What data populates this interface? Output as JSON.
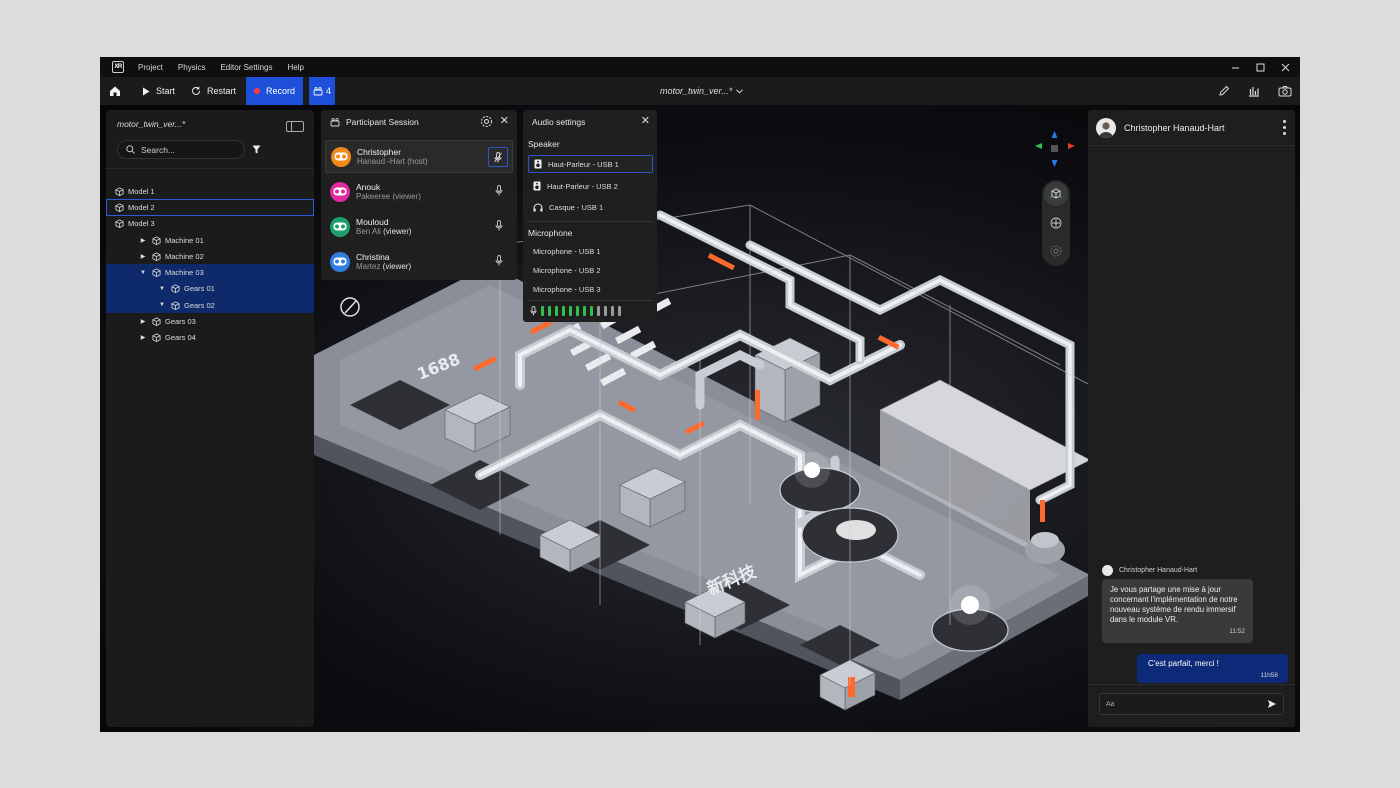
{
  "menubar": {
    "logo_text": "XR",
    "items": [
      "Project",
      "Physics",
      "Editor Settings",
      "Help"
    ]
  },
  "toolbar": {
    "start_label": "Start",
    "restart_label": "Restart",
    "record_label": "Record",
    "participants_count": "4",
    "document_title": "motor_twin_ver...*"
  },
  "scene_panel": {
    "title": "motor_twin_ver...*",
    "search_placeholder": "Search...",
    "tree": [
      {
        "label": "Model 1",
        "depth": 0,
        "arrow": ""
      },
      {
        "label": "Model 2",
        "depth": 0,
        "arrow": "",
        "state": "outline"
      },
      {
        "label": "Model 3",
        "depth": 0,
        "arrow": ""
      },
      {
        "label": "Machine 01",
        "depth": 1,
        "arrow": "▶"
      },
      {
        "label": "Machine 02",
        "depth": 1,
        "arrow": "▶"
      },
      {
        "label": "Machine 03",
        "depth": 1,
        "arrow": "▼",
        "state": "fill"
      },
      {
        "label": "Gears 01",
        "depth": 2,
        "arrow": "▼",
        "state": "fill"
      },
      {
        "label": "Gears 02",
        "depth": 2,
        "arrow": "▼",
        "state": "fill"
      },
      {
        "label": "Gears 03",
        "depth": 1,
        "arrow": "▶"
      },
      {
        "label": "Gears 04",
        "depth": 1,
        "arrow": "▶"
      }
    ]
  },
  "participant_panel": {
    "title": "Participant Session",
    "participants": [
      {
        "name": "Christopher",
        "sub": "Hanaud -Hart (host)",
        "role": "",
        "color": "#f08a1c",
        "active": true
      },
      {
        "name": "Anouk",
        "sub": "Pakeeree (viewer)",
        "role": "",
        "color": "#e02aa0",
        "active": false
      },
      {
        "name": "Mouloud",
        "sub": "Ben Ali ",
        "role": "(viewer)",
        "color": "#1e9e6a",
        "active": false
      },
      {
        "name": "Christina",
        "sub": "Martez ",
        "role": "(viewer)",
        "color": "#2f7ee0",
        "active": false
      }
    ]
  },
  "audio_panel": {
    "title": "Audio settings",
    "speaker_label": "Speaker",
    "speakers": [
      "Haut-Parleur - USB 1",
      "Haut-Parleur - USB 2",
      "Casque - USB 1"
    ],
    "microphone_label": "Microphone",
    "microphones": [
      "Microphone - USB 1",
      "Microphone - USB 2",
      "Microphone - USB 3"
    ],
    "input_level_active_bars": 8,
    "input_level_total_bars": 12
  },
  "chat_panel": {
    "contact_name": "Christopher Hanaud-Hart",
    "messages": [
      {
        "author": "Christopher Hanaud-Hart",
        "text": "Je vous partage une mise à jour concernant l'implémentation de notre nouveau système de rendu immersif dans le module VR.",
        "time": "11:52"
      },
      {
        "text": "C'est parfait, merci !",
        "time": "11h58"
      }
    ],
    "input_placeholder": "Aa"
  },
  "colors": {
    "accent": "#1e4fd8",
    "selection": "#0e2a6b",
    "record_dot": "#ff3b3b",
    "level_on": "#2fbf4a",
    "level_off": "#9a9a9a"
  },
  "viewport": {
    "signs": [
      "新科技",
      "1688"
    ]
  }
}
